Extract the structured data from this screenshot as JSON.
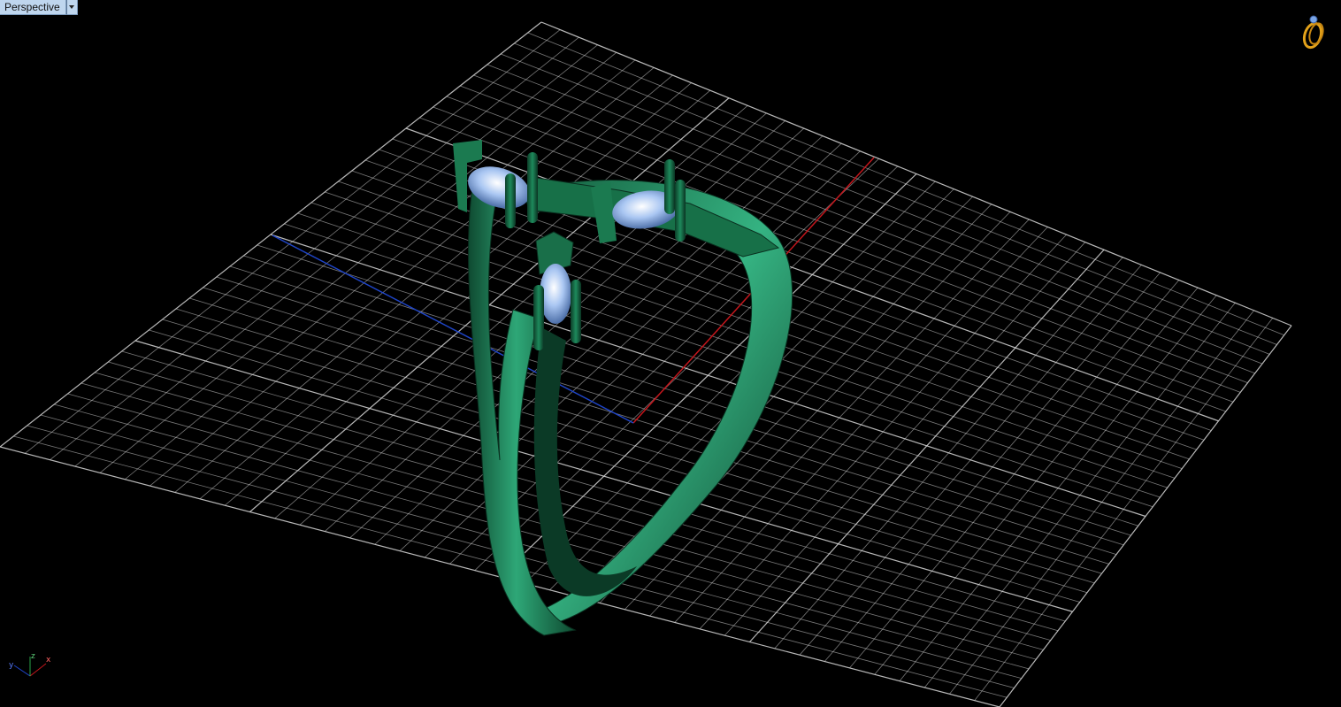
{
  "viewport": {
    "title": "Perspective",
    "menu_icon": "chevron-down-icon",
    "background": "#000000"
  },
  "scene": {
    "object": "ring-model",
    "material_color": "#1f7d55",
    "gem_color": "#a9c6f2",
    "grid_color": "#d8d8d8",
    "x_axis_color": "#c4161c",
    "y_axis_color": "#1f45c8"
  },
  "axes_widget": {
    "y": "y",
    "z": "z",
    "x": "x"
  },
  "top_right_icon": "ring-thumbnail-icon"
}
